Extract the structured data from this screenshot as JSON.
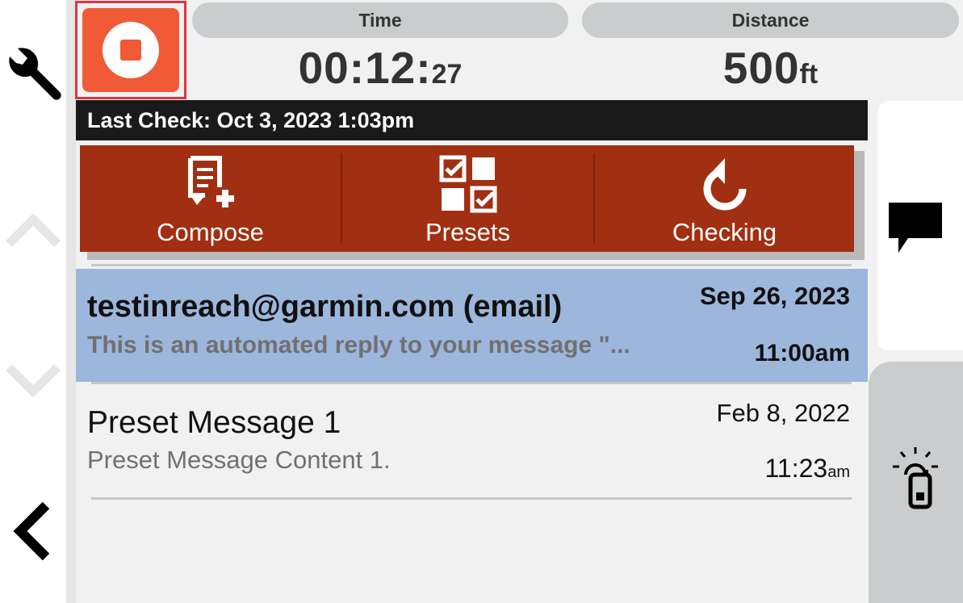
{
  "stats": {
    "time_label": "Time",
    "time_main": "00:12:",
    "time_seconds": "27",
    "distance_label": "Distance",
    "distance_value": "500",
    "distance_unit": "ft"
  },
  "last_check": "Last Check: Oct 3, 2023 1:03pm",
  "actions": {
    "compose": "Compose",
    "presets": "Presets",
    "checking": "Checking"
  },
  "messages": [
    {
      "from": "testinreach@garmin.com (email)",
      "preview": "This is an automated reply to your message \"...",
      "date": "Sep 26, 2023",
      "time": "11:00am"
    },
    {
      "from": "Preset Message 1",
      "preview": "Preset Message Content 1.",
      "date": "Feb 8, 2022",
      "time": "11:23",
      "time_suffix": "am"
    }
  ],
  "colors": {
    "stop_red": "#f05a37",
    "action_bar": "#a12f12",
    "selected_row": "#9db6dc",
    "header_bar": "#1a1a1a"
  },
  "icons": {
    "settings": "wrench-icon",
    "up": "chevron-up-icon",
    "down": "chevron-down-icon",
    "back": "chevron-left-icon",
    "stop": "stop-icon",
    "compose": "compose-icon",
    "presets": "presets-icon",
    "checking": "refresh-icon",
    "messages": "speech-bubble-icon",
    "device": "device-beacon-icon"
  }
}
